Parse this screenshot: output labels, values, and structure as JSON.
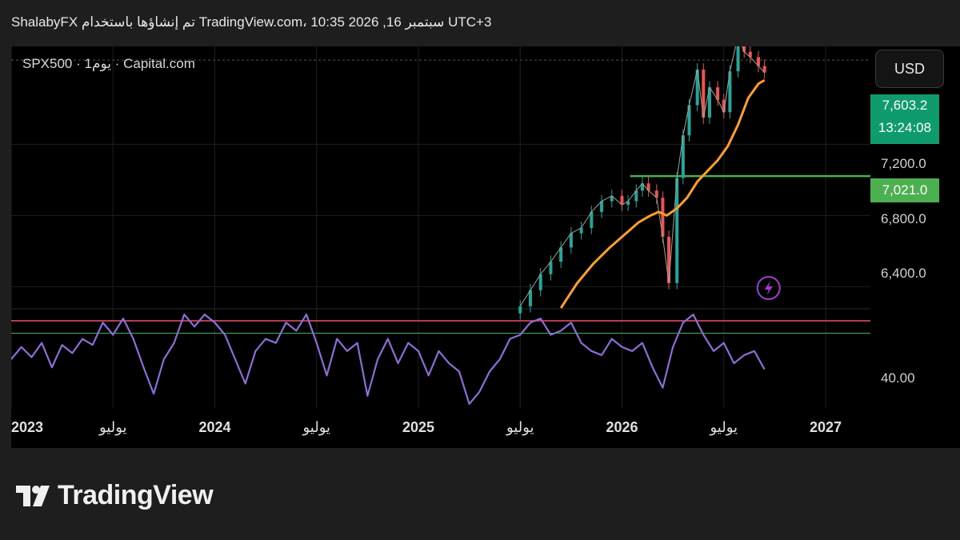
{
  "header": {
    "text": "ShalabyFX تم إنشاؤها باستخدام TradingView.com، 10:35 2026 ,16 سبتمبر UTC+3"
  },
  "symbol": {
    "label": "SPX500 · يوم1 · Capital.com"
  },
  "axis": {
    "currency": "USD"
  },
  "badges": {
    "last_price": "7,603.2",
    "countdown": "13:24:08",
    "level": "7,021.0"
  },
  "colors": {
    "up": "#26a69a",
    "down": "#ef5350",
    "ma": "#ff9d2e",
    "level": "#4caf50",
    "rsi": "#8e6bd8",
    "rsi_upper": "#f0506e",
    "rsi_lower": "#4caf50",
    "alert": "#a13bd1"
  },
  "brand": {
    "name": "TradingView"
  },
  "chart_data": {
    "type": "line",
    "price_axis": {
      "ticks": [
        "7,200.0",
        "6,800.0",
        "6,400.0"
      ],
      "tick_values": [
        7200,
        6800,
        6400
      ],
      "ylim": [
        6280,
        7750
      ]
    },
    "rsi_axis": {
      "ticks": [
        "40.00"
      ],
      "tick_values": [
        40
      ],
      "ylim": [
        28,
        75
      ],
      "upper": 70,
      "lower": 64
    },
    "time_axis": {
      "labels": [
        "2023",
        "يوليو",
        "2024",
        "يوليو",
        "2025",
        "يوليو",
        "2026",
        "يوليو",
        "2027"
      ],
      "x": [
        2023.0,
        2023.5,
        2024.0,
        2024.5,
        2025.0,
        2025.5,
        2026.0,
        2026.5,
        2027.0
      ],
      "major": [
        true,
        false,
        true,
        false,
        true,
        false,
        true,
        false,
        true
      ],
      "xlim": [
        2023.0,
        2027.22
      ]
    },
    "series": [
      {
        "name": "SPX500",
        "x": [
          2025.5,
          2025.55,
          2025.6,
          2025.65,
          2025.7,
          2025.75,
          2025.8,
          2025.85,
          2025.9,
          2025.95,
          2026.0,
          2026.03,
          2026.07,
          2026.1,
          2026.13,
          2026.17,
          2026.2,
          2026.23,
          2026.27,
          2026.3,
          2026.33,
          2026.37,
          2026.4,
          2026.43,
          2026.47,
          2026.5,
          2026.53,
          2026.57,
          2026.6,
          2026.63,
          2026.67,
          2026.7
        ],
        "values": [
          6290,
          6380,
          6470,
          6540,
          6620,
          6700,
          6730,
          6820,
          6880,
          6910,
          6860,
          6880,
          6940,
          6980,
          6940,
          6900,
          6680,
          6420,
          7010,
          7250,
          7420,
          7620,
          7350,
          7520,
          7450,
          7380,
          7610,
          7810,
          7720,
          7690,
          7640,
          7603.2
        ]
      },
      {
        "name": "",
        "x": [
          2025.7,
          2025.78,
          2025.86,
          2025.94,
          2026.02,
          2026.08,
          2026.14,
          2026.18,
          2026.22,
          2026.27,
          2026.32,
          2026.37,
          2026.42,
          2026.47,
          2026.52,
          2026.57,
          2026.62,
          2026.67,
          2026.7
        ],
        "values": [
          6280,
          6420,
          6530,
          6620,
          6700,
          6760,
          6800,
          6820,
          6800,
          6840,
          6900,
          6990,
          7050,
          7110,
          7190,
          7310,
          7460,
          7540,
          7560
        ]
      }
    ],
    "levels": [
      {
        "value": 7021.0,
        "x_start": 2026.04
      }
    ],
    "rsi": {
      "x": [
        2023.0,
        2023.05,
        2023.1,
        2023.15,
        2023.2,
        2023.25,
        2023.3,
        2023.35,
        2023.4,
        2023.45,
        2023.5,
        2023.55,
        2023.6,
        2023.65,
        2023.7,
        2023.75,
        2023.8,
        2023.85,
        2023.9,
        2023.95,
        2024.0,
        2024.05,
        2024.1,
        2024.15,
        2024.2,
        2024.25,
        2024.3,
        2024.35,
        2024.4,
        2024.45,
        2024.5,
        2024.55,
        2024.6,
        2024.65,
        2024.7,
        2024.75,
        2024.8,
        2024.85,
        2024.9,
        2024.95,
        2025.0,
        2025.05,
        2025.1,
        2025.15,
        2025.2,
        2025.25,
        2025.3,
        2025.35,
        2025.4,
        2025.45,
        2025.5,
        2025.55,
        2025.6,
        2025.65,
        2025.7,
        2025.75,
        2025.8,
        2025.85,
        2025.9,
        2025.95,
        2026.0,
        2026.05,
        2026.1,
        2026.15,
        2026.2,
        2026.25,
        2026.3,
        2026.35,
        2026.4,
        2026.45,
        2026.5,
        2026.55,
        2026.6,
        2026.65,
        2026.7
      ],
      "values": [
        62,
        68,
        63,
        70,
        58,
        69,
        65,
        72,
        69,
        80,
        74,
        82,
        72,
        58,
        45,
        62,
        70,
        84,
        78,
        84,
        80,
        74,
        62,
        50,
        66,
        72,
        70,
        80,
        76,
        84,
        70,
        54,
        72,
        66,
        70,
        44,
        62,
        72,
        60,
        70,
        66,
        54,
        66,
        60,
        56,
        40,
        46,
        56,
        62,
        72,
        74,
        80,
        82,
        74,
        76,
        80,
        70,
        66,
        64,
        72,
        68,
        66,
        70,
        58,
        48,
        68,
        80,
        84,
        74,
        66,
        70,
        60,
        64,
        66,
        57
      ]
    }
  }
}
